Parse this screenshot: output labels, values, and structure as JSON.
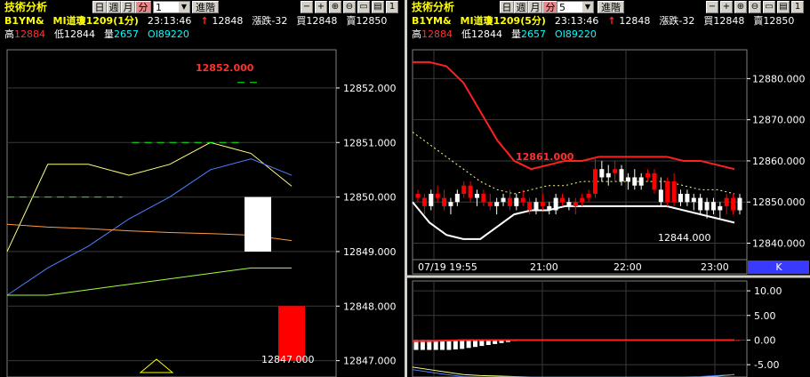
{
  "left": {
    "toolbar": {
      "title": "技術分析",
      "btn_day": "日",
      "btn_week": "週",
      "btn_month": "月",
      "btn_min": "分",
      "period": "1",
      "advanced": "進階"
    },
    "quote": {
      "symbol": "B1YM&",
      "name": "MI道瓊1209(1分)",
      "time": "23:13:46",
      "arrow": "↑",
      "last": "12848",
      "change": "漲跌-32",
      "bid": "買12848",
      "ask": "賣12850"
    },
    "stats": {
      "high_label": "高",
      "high": "12884",
      "low_label": "低",
      "low": "12844",
      "vol_label": "量",
      "vol": "2657",
      "oi_label": "OI",
      "oi": "89220"
    },
    "annotations": {
      "high_mark": "12852.000",
      "low_mark": "12847.000"
    }
  },
  "right": {
    "toolbar": {
      "title": "技術分析",
      "btn_day": "日",
      "btn_week": "週",
      "btn_month": "月",
      "btn_min": "分",
      "period": "5",
      "advanced": "進階"
    },
    "quote": {
      "symbol": "B1YM&",
      "name": "MI道瓊1209(5分)",
      "time": "23:13:46",
      "arrow": "↑",
      "last": "12848",
      "change": "漲跌-32",
      "bid": "買12848",
      "ask": "賣12850"
    },
    "stats": {
      "high_label": "高",
      "high": "12884",
      "low_label": "低",
      "low": "12844",
      "vol_label": "量",
      "vol": "2657",
      "oi_label": "OI",
      "oi": "89220"
    },
    "annotations": {
      "high_mark": "12861.000",
      "low_mark": "12844.000"
    },
    "x_labels": [
      "07/19 19:55",
      "21:00",
      "22:00",
      "23:00"
    ],
    "k_label": "K"
  },
  "colors": {
    "up": "#ffffff",
    "down": "#ff0000",
    "grid": "#3a3a3a",
    "axis_text": "#ffffff",
    "accent_btn": "#e98a8a"
  },
  "icons": [
    "minus-icon",
    "plus-icon",
    "zoom-in-icon",
    "zoom-out-icon",
    "save-icon",
    "print-icon",
    "info-icon"
  ],
  "chart_data": [
    {
      "type": "candlestick",
      "title": "MI道瓊1209(1分)",
      "ylim": [
        12846.7,
        12852.7
      ],
      "y_ticks": [
        12847.0,
        12848.0,
        12849.0,
        12850.0,
        12851.0,
        12852.0
      ],
      "candles": [
        {
          "open": 12849.0,
          "high": 12850.0,
          "low": 12849.0,
          "close": 12850.0,
          "color": "up"
        },
        {
          "open": 12848.0,
          "high": 12848.0,
          "low": 12847.0,
          "close": 12847.0,
          "color": "down"
        }
      ],
      "series": [
        {
          "color": "#ffff80",
          "values": [
            12849.0,
            12850.6,
            12850.6,
            12850.4,
            12850.6,
            12851.0,
            12850.8,
            12850.2
          ]
        },
        {
          "color": "#5080ff",
          "values": [
            12848.2,
            12848.7,
            12849.1,
            12849.6,
            12850.0,
            12850.5,
            12850.7,
            12850.4
          ]
        },
        {
          "color": "#ff9a40",
          "values": [
            12849.5,
            12849.45,
            12849.42,
            12849.38,
            12849.35,
            12849.33,
            12849.3,
            12849.2
          ]
        },
        {
          "color": "#a0ff40",
          "values": [
            12848.2,
            12848.2,
            12848.3,
            12848.4,
            12848.5,
            12848.6,
            12848.7,
            12848.7
          ]
        }
      ],
      "dashes": [
        {
          "color": "#00ff00",
          "y": 12850.0,
          "x": [
            0.0,
            0.35
          ]
        },
        {
          "color": "#00ff00",
          "y": 12851.0,
          "x": [
            0.38,
            0.72
          ]
        },
        {
          "color": "#00ff00",
          "y": 12852.1,
          "x": [
            0.7,
            0.76
          ]
        }
      ]
    },
    {
      "type": "candlestick",
      "title": "MI道瓊1209(5分)",
      "ylim": [
        12836.0,
        12887.0
      ],
      "y_ticks": [
        12840.0,
        12850.0,
        12860.0,
        12870.0,
        12880.0
      ],
      "x_ticks": [
        "07/19 19:55",
        "21:00",
        "22:00",
        "23:00"
      ],
      "candles": [
        {
          "open": 12852,
          "high": 12853,
          "low": 12850,
          "close": 12851,
          "color": "down"
        },
        {
          "open": 12851,
          "high": 12852,
          "low": 12847,
          "close": 12849,
          "color": "down"
        },
        {
          "open": 12849,
          "high": 12853,
          "low": 12848,
          "close": 12852,
          "color": "up"
        },
        {
          "open": 12852,
          "high": 12854,
          "low": 12850,
          "close": 12851,
          "color": "down"
        },
        {
          "open": 12851,
          "high": 12853,
          "low": 12848,
          "close": 12849,
          "color": "down"
        },
        {
          "open": 12849,
          "high": 12851,
          "low": 12847,
          "close": 12850,
          "color": "up"
        },
        {
          "open": 12850,
          "high": 12853,
          "low": 12849,
          "close": 12852,
          "color": "up"
        },
        {
          "open": 12852,
          "high": 12855,
          "low": 12851,
          "close": 12854,
          "color": "down"
        },
        {
          "open": 12854,
          "high": 12855,
          "low": 12850,
          "close": 12851,
          "color": "down"
        },
        {
          "open": 12851,
          "high": 12853,
          "low": 12849,
          "close": 12852,
          "color": "up"
        },
        {
          "open": 12852,
          "high": 12853,
          "low": 12849,
          "close": 12850,
          "color": "down"
        },
        {
          "open": 12850,
          "high": 12852,
          "low": 12848,
          "close": 12849,
          "color": "down"
        },
        {
          "open": 12849,
          "high": 12851,
          "low": 12847,
          "close": 12850,
          "color": "up"
        },
        {
          "open": 12850,
          "high": 12852,
          "low": 12849,
          "close": 12851,
          "color": "up"
        },
        {
          "open": 12851,
          "high": 12853,
          "low": 12848,
          "close": 12849,
          "color": "down"
        },
        {
          "open": 12849,
          "high": 12852,
          "low": 12848,
          "close": 12851,
          "color": "up"
        },
        {
          "open": 12851,
          "high": 12853,
          "low": 12849,
          "close": 12850,
          "color": "down"
        },
        {
          "open": 12850,
          "high": 12851,
          "low": 12847,
          "close": 12848,
          "color": "down"
        },
        {
          "open": 12848,
          "high": 12851,
          "low": 12847,
          "close": 12850,
          "color": "up"
        },
        {
          "open": 12850,
          "high": 12852,
          "low": 12848,
          "close": 12849,
          "color": "down"
        },
        {
          "open": 12849,
          "high": 12850,
          "low": 12847,
          "close": 12848,
          "color": "up"
        },
        {
          "open": 12848,
          "high": 12852,
          "low": 12847,
          "close": 12851,
          "color": "up"
        },
        {
          "open": 12851,
          "high": 12852,
          "low": 12849,
          "close": 12850,
          "color": "down"
        },
        {
          "open": 12850,
          "high": 12851,
          "low": 12848,
          "close": 12849,
          "color": "up"
        },
        {
          "open": 12849,
          "high": 12851,
          "low": 12847,
          "close": 12850,
          "color": "down"
        },
        {
          "open": 12850,
          "high": 12852,
          "low": 12849,
          "close": 12851,
          "color": "down"
        },
        {
          "open": 12851,
          "high": 12853,
          "low": 12850,
          "close": 12852,
          "color": "down"
        },
        {
          "open": 12852,
          "high": 12861,
          "low": 12851,
          "close": 12858,
          "color": "down"
        },
        {
          "open": 12858,
          "high": 12860,
          "low": 12855,
          "close": 12856,
          "color": "up"
        },
        {
          "open": 12856,
          "high": 12859,
          "low": 12854,
          "close": 12857,
          "color": "up"
        },
        {
          "open": 12857,
          "high": 12860,
          "low": 12855,
          "close": 12858,
          "color": "down"
        },
        {
          "open": 12858,
          "high": 12859,
          "low": 12854,
          "close": 12855,
          "color": "up"
        },
        {
          "open": 12855,
          "high": 12857,
          "low": 12853,
          "close": 12856,
          "color": "up"
        },
        {
          "open": 12856,
          "high": 12858,
          "low": 12853,
          "close": 12854,
          "color": "up"
        },
        {
          "open": 12854,
          "high": 12857,
          "low": 12853,
          "close": 12856,
          "color": "up"
        },
        {
          "open": 12856,
          "high": 12858,
          "low": 12855,
          "close": 12857,
          "color": "down"
        },
        {
          "open": 12857,
          "high": 12858,
          "low": 12852,
          "close": 12853,
          "color": "down"
        },
        {
          "open": 12853,
          "high": 12856,
          "low": 12849,
          "close": 12850,
          "color": "up"
        },
        {
          "open": 12850,
          "high": 12856,
          "low": 12849,
          "close": 12855,
          "color": "down"
        },
        {
          "open": 12855,
          "high": 12857,
          "low": 12849,
          "close": 12850,
          "color": "down"
        },
        {
          "open": 12850,
          "high": 12853,
          "low": 12849,
          "close": 12852,
          "color": "up"
        },
        {
          "open": 12852,
          "high": 12853,
          "low": 12849,
          "close": 12850,
          "color": "up"
        },
        {
          "open": 12850,
          "high": 12852,
          "low": 12848,
          "close": 12851,
          "color": "up"
        },
        {
          "open": 12851,
          "high": 12852,
          "low": 12847,
          "close": 12848,
          "color": "up"
        },
        {
          "open": 12848,
          "high": 12851,
          "low": 12846,
          "close": 12850,
          "color": "up"
        },
        {
          "open": 12850,
          "high": 12851,
          "low": 12847,
          "close": 12848,
          "color": "up"
        },
        {
          "open": 12848,
          "high": 12850,
          "low": 12846,
          "close": 12849,
          "color": "up"
        },
        {
          "open": 12849,
          "high": 12852,
          "low": 12847,
          "close": 12851,
          "color": "down"
        },
        {
          "open": 12851,
          "high": 12852,
          "low": 12847,
          "close": 12848,
          "color": "down"
        },
        {
          "open": 12848,
          "high": 12852,
          "low": 12847,
          "close": 12851,
          "color": "up"
        }
      ],
      "series": [
        {
          "name_hint": "upper",
          "color": "#ff2020",
          "values": [
            12884,
            12884,
            12883,
            12879,
            12872,
            12865,
            12860,
            12858,
            12859,
            12860,
            12860,
            12861,
            12861,
            12861,
            12861,
            12861,
            12860,
            12860,
            12859,
            12858
          ]
        },
        {
          "name_hint": "lower",
          "color": "#ffffff",
          "values": [
            12850,
            12845,
            12842,
            12841,
            12841,
            12844,
            12847,
            12848,
            12848,
            12849,
            12849,
            12849,
            12849,
            12849,
            12849,
            12849,
            12848,
            12847,
            12846,
            12845
          ]
        },
        {
          "name_hint": "mid",
          "color": "#ffff80",
          "values": [
            12867,
            12864,
            12861,
            12858,
            12855,
            12853,
            12852,
            12853,
            12854,
            12854,
            12855,
            12855,
            12855,
            12855,
            12855,
            12855,
            12854,
            12853,
            12853,
            12852
          ]
        }
      ]
    },
    {
      "type": "bar",
      "title": "",
      "ylim": [
        -7.5,
        12.0
      ],
      "y_ticks": [
        10.0,
        5.0,
        0.0,
        -5.0
      ],
      "values": [
        -2.0,
        -2.0,
        -2.0,
        -2.0,
        -2.0,
        -2.0,
        -1.9,
        -1.8,
        -1.6,
        -1.4,
        -1.2,
        -1.0,
        -0.8,
        -0.6,
        -0.4,
        -0.2,
        0,
        0,
        0,
        0,
        0,
        0,
        0.05,
        0.05,
        0.05,
        0.05,
        0.05,
        0.05,
        0.05,
        0.05,
        0.05,
        0.05,
        0.05,
        0.05,
        0,
        0,
        0,
        0,
        0,
        0,
        0,
        0,
        0,
        0,
        0,
        0,
        0,
        0,
        0,
        0
      ],
      "series": [
        {
          "color": "#ff2020",
          "values": [
            -0.2,
            -0.2,
            -0.1,
            0,
            0,
            0,
            0,
            0,
            0,
            0,
            0,
            0,
            0,
            0,
            0,
            0,
            0,
            0,
            0,
            0
          ]
        },
        {
          "color": "#ffff80",
          "values": [
            -5.5,
            -6.0,
            -6.5,
            -7.0,
            -7.2,
            -7.3,
            -7.4,
            -7.5,
            -7.5,
            -7.5,
            -7.5,
            -7.5,
            -7.5,
            -7.5,
            -7.5,
            -7.5,
            -7.5,
            -7.5,
            -7.3,
            -7.0
          ]
        },
        {
          "color": "#5080ff",
          "values": [
            -6.0,
            -6.5,
            -7.0,
            -7.4,
            -7.5,
            -7.5,
            -7.5,
            -7.5,
            -7.5,
            -7.5,
            -7.5,
            -7.5,
            -7.5,
            -7.5,
            -7.5,
            -7.5,
            -7.5,
            -7.4,
            -7.2,
            -7.0
          ]
        }
      ]
    }
  ]
}
